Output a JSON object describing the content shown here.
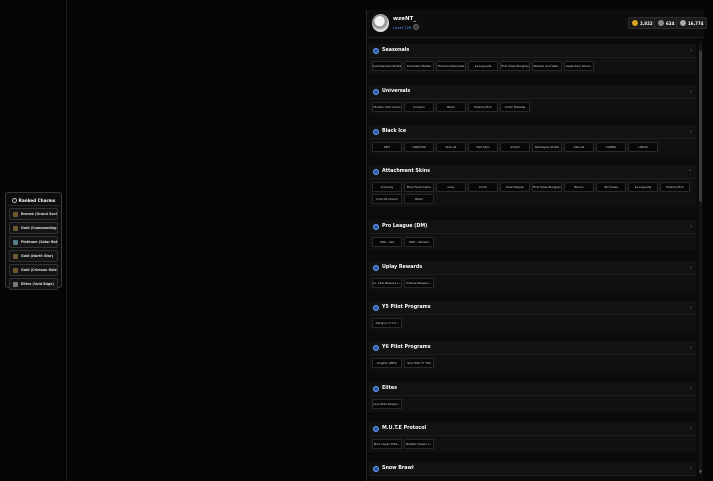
{
  "user": {
    "name": "wzeNT_",
    "level": "Level 126"
  },
  "currencies": [
    {
      "name": "gold-coin-icon",
      "value": "2,822",
      "color": "#d9a520"
    },
    {
      "name": "token-icon",
      "value": "624",
      "color": "#8a8a8a"
    },
    {
      "name": "credits-icon",
      "value": "16,774",
      "color": "#aaaaaa"
    }
  ],
  "ranked": {
    "title": "Ranked Charms",
    "items": [
      {
        "label": "Bronze (Grand Savior)",
        "tier": "gold"
      },
      {
        "label": "Gold (Commanding F...",
        "tier": "gold"
      },
      {
        "label": "Platinum (Solar Bath)",
        "tier": "plat"
      },
      {
        "label": "Gold (North Star)",
        "tier": "gold"
      },
      {
        "label": "Gold (Crimson Gale)",
        "tier": "gold"
      },
      {
        "label": "Elites (Void Edge)",
        "tier": "elite"
      }
    ]
  },
  "sections": [
    {
      "title": "Seasonals",
      "chev": "›",
      "items": [
        "Sunbleached Strata",
        "Sunbeam Stalker",
        "Thermal Sekundes",
        "La Leyenda",
        "First Class Burglary",
        "Mission and Vast...",
        "Legendary Silver..."
      ]
    },
    {
      "title": "Universals",
      "chev": "›",
      "items": [
        "Modern USA Camo",
        "Crimson",
        "Black",
        "Plasma Pink",
        "Arctic Maladie"
      ]
    },
    {
      "title": "Black Ice",
      "chev": "›",
      "items": [
        "MP7",
        "CSRX300",
        "AUG A2",
        "P10 Shm",
        "ACS12",
        "Mantagne Shield",
        "ASG A2",
        "CAMRS",
        "USP40"
      ]
    },
    {
      "title": "Attachment Skins",
      "chev": "⌃",
      "items": [
        "Anomaly",
        "Blue Hued Camo",
        "Gray",
        "Arctic",
        "Pearl Ripple",
        "First Class Burglary",
        "Brown",
        "Tall Grass",
        "La Leyenda",
        "Plasma Pink",
        "Colorful Charm",
        "Black"
      ]
    },
    {
      "title": "Pro League (DM)",
      "chev": "›",
      "items": [
        "PRO - Set",
        "PRO - Stonart"
      ]
    },
    {
      "title": "Uplay Rewards",
      "chev": "›",
      "items": [
        "Lv. Club Reward L...",
        "Octane Weapon..."
      ]
    },
    {
      "title": "Y5 Pilot Programs",
      "chev": "›",
      "items": [
        "Darkjinn 3 Y-5..."
      ]
    },
    {
      "title": "Y6 Pilot Programs",
      "chev": "›",
      "items": [
        "Knights (MP5)",
        "Skin 506 YY Y6S"
      ]
    },
    {
      "title": "Elites",
      "chev": "›",
      "items": [
        "Iana Elite Design..."
      ]
    },
    {
      "title": "M.U.T.E Protocol",
      "chev": "›",
      "items": [
        "Mira Imperi Elite...",
        "Nobled Classic L..."
      ]
    },
    {
      "title": "Snow Brawl",
      "chev": "›",
      "items": []
    }
  ]
}
